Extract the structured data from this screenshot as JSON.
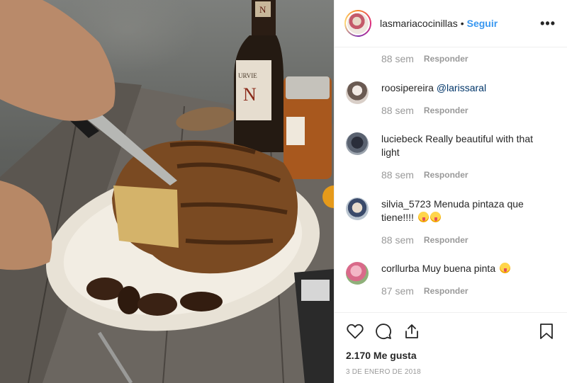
{
  "post": {
    "username": "lasmariacocinillas",
    "separator": "•",
    "follow_label": "Seguir",
    "more_label": "•••"
  },
  "first_meta": {
    "time": "88 sem",
    "reply": "Responder"
  },
  "comments": [
    {
      "user": "roosipereira",
      "mention": "@larissaral",
      "text": "",
      "time": "88 sem",
      "reply": "Responder",
      "avatar": "avatar-roosipereira"
    },
    {
      "user": "luciebeck",
      "mention": "",
      "text": "Really beautiful with that light",
      "time": "88 sem",
      "reply": "Responder",
      "avatar": "avatar-luciebeck"
    },
    {
      "user": "silvia_5723",
      "mention": "",
      "text": "Menuda pintaza que tiene!!!!",
      "time": "88 sem",
      "reply": "Responder",
      "avatar": "avatar-silvia"
    },
    {
      "user": "corllurba",
      "mention": "",
      "text": "Muy buena pinta",
      "time": "87 sem",
      "reply": "Responder",
      "avatar": "avatar-corllurba"
    }
  ],
  "footer": {
    "likes": "2.170 Me gusta",
    "date": "3 DE ENERO DE 2018"
  },
  "icons": [
    "heart-icon",
    "comment-icon",
    "share-icon",
    "bookmark-icon"
  ],
  "colors": {
    "link": "#3897f0",
    "muted": "#999999",
    "text": "#262626"
  }
}
